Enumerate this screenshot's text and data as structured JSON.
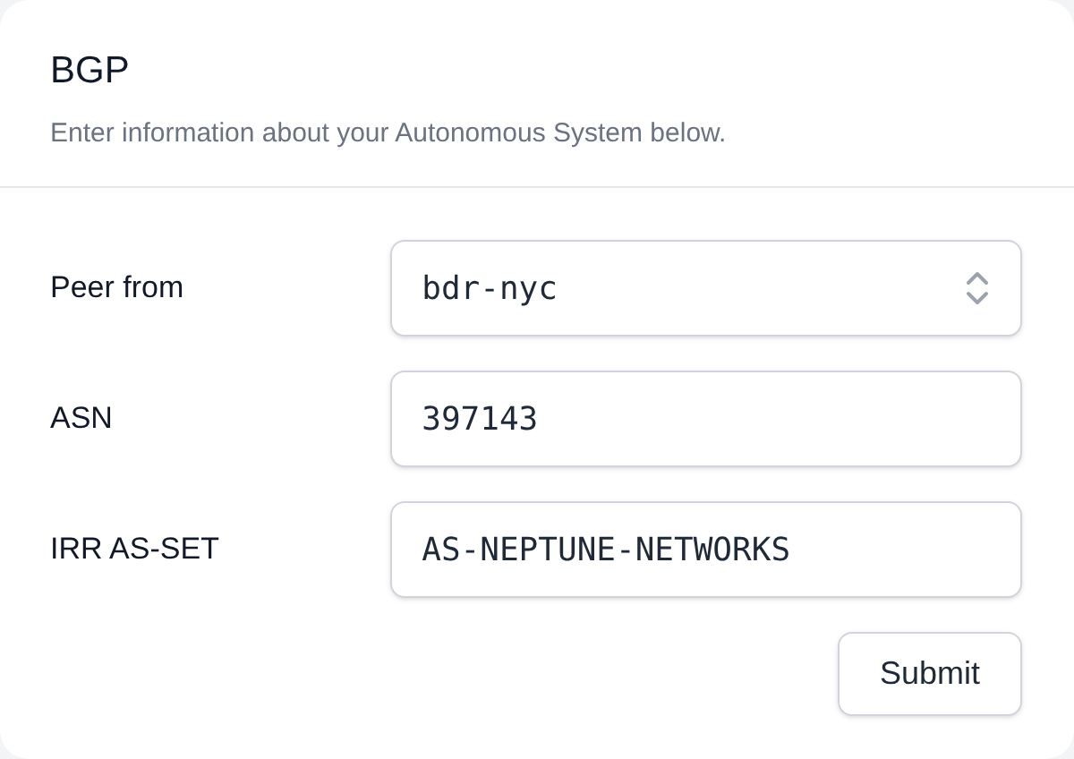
{
  "card": {
    "title": "BGP",
    "description": "Enter information about your Autonomous System below."
  },
  "fields": [
    {
      "label": "Peer from",
      "kind": "select",
      "value": "bdr-nyc"
    },
    {
      "label": "ASN",
      "kind": "text",
      "value": "397143"
    },
    {
      "label": "IRR AS-SET",
      "kind": "text",
      "value": "AS-NEPTUNE-NETWORKS"
    }
  ],
  "submit": {
    "label": "Submit"
  }
}
